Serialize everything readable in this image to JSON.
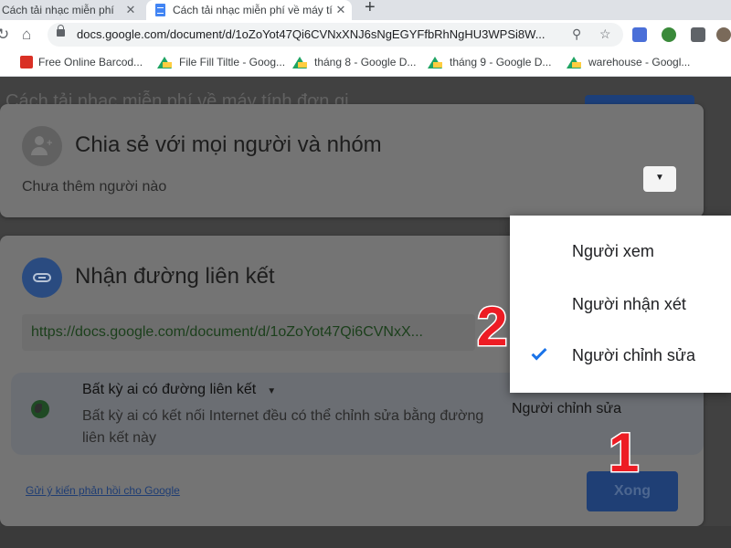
{
  "browser": {
    "tabs": [
      {
        "title": "Cách tải nhạc miễn phí"
      },
      {
        "title": "Cách tải nhạc miễn phí về máy tí"
      }
    ],
    "url": "docs.google.com/document/d/1oZoYot47Qi6CVNxXNJ6sNgEGYFfbRhNgHU3WPSi8W...",
    "bookmarks": [
      {
        "label": "Free Online Barcod..."
      },
      {
        "label": "File Fill Tiltle - Goog..."
      },
      {
        "label": "tháng 8 - Google D..."
      },
      {
        "label": "tháng 9 - Google D..."
      },
      {
        "label": "warehouse - Googl..."
      }
    ]
  },
  "document": {
    "title": "Cách tải nhạc miễn phí về máy tính đơn gi"
  },
  "share_dialog": {
    "share_section": {
      "title": "Chia sẻ với mọi người và nhóm",
      "subtitle": "Chưa thêm người nào"
    },
    "link_section": {
      "title": "Nhận đường liên kết",
      "url": "https://docs.google.com/document/d/1oZoYot47Qi6CVNxX...",
      "access_title": "Bất kỳ ai có đường liên kết",
      "access_description": "Bất kỳ ai có kết nối Internet đều có thể chỉnh sửa bằng đường liên kết này",
      "role_selected": "Người chỉnh sửa"
    },
    "feedback_label": "Gửi ý kiến phản hồi cho Google",
    "done_label": "Xong"
  },
  "role_menu": {
    "items": [
      {
        "label": "Người xem",
        "selected": false
      },
      {
        "label": "Người nhận xét",
        "selected": false
      },
      {
        "label": "Người chỉnh sửa",
        "selected": true
      }
    ]
  },
  "annotations": {
    "step_1": "1",
    "step_2": "2",
    "color": "#ed1c24"
  },
  "colors": {
    "accent": "#1a73e8",
    "overlay_dim": "#747474"
  }
}
